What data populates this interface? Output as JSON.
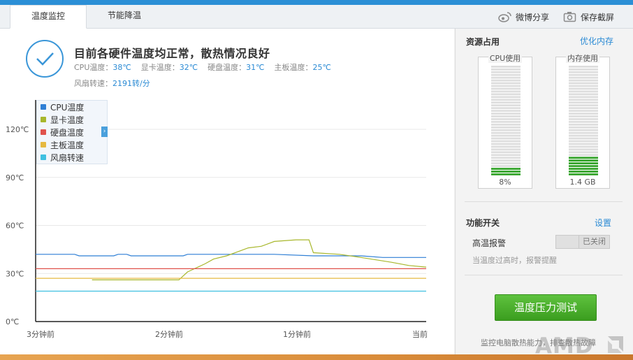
{
  "tabs": [
    {
      "label": "温度监控",
      "active": true
    },
    {
      "label": "节能降温",
      "active": false
    }
  ],
  "toolbar": {
    "share_label": "微博分享",
    "screenshot_label": "保存截屏"
  },
  "status": {
    "headline": "目前各硬件温度均正常，散热情况良好",
    "cpu_label": "CPU温度：",
    "cpu_value": "38℃",
    "gpu_label": "显卡温度：",
    "gpu_value": "32℃",
    "disk_label": "硬盘温度：",
    "disk_value": "31℃",
    "board_label": "主板温度：",
    "board_value": "25℃",
    "fan_label": "风扇转速：",
    "fan_value": "2191转/分"
  },
  "chart_data": {
    "type": "line",
    "y_ticks": [
      "120℃",
      "90℃",
      "60℃",
      "30℃",
      "0℃"
    ],
    "ylim": [
      0,
      120
    ],
    "x_ticks": [
      "3分钟前",
      "2分钟前",
      "1分钟前",
      "当前"
    ],
    "xlim": [
      0,
      180
    ],
    "grid": true,
    "legend_position": "top-left",
    "series": [
      {
        "name": "CPU温度",
        "color": "#2f7fd5",
        "points": [
          [
            0,
            42
          ],
          [
            18,
            42
          ],
          [
            20,
            41
          ],
          [
            36,
            41
          ],
          [
            38,
            42
          ],
          [
            42,
            42
          ],
          [
            44,
            41
          ],
          [
            66,
            41
          ],
          [
            68,
            41
          ],
          [
            70,
            42
          ],
          [
            110,
            42
          ],
          [
            128,
            41
          ],
          [
            140,
            41
          ],
          [
            150,
            41
          ],
          [
            160,
            40
          ],
          [
            180,
            40
          ]
        ]
      },
      {
        "name": "显卡温度",
        "color": "#a8b72c",
        "points": [
          [
            26,
            26
          ],
          [
            66,
            26
          ],
          [
            70,
            31
          ],
          [
            78,
            36
          ],
          [
            82,
            39
          ],
          [
            88,
            41
          ],
          [
            94,
            44
          ],
          [
            98,
            46
          ],
          [
            104,
            47
          ],
          [
            110,
            50
          ],
          [
            120,
            51
          ],
          [
            126,
            51
          ],
          [
            128,
            43
          ],
          [
            140,
            42
          ],
          [
            150,
            40
          ],
          [
            164,
            37
          ],
          [
            172,
            35
          ],
          [
            180,
            34
          ]
        ]
      },
      {
        "name": "硬盘温度",
        "color": "#e0524c",
        "points": [
          [
            0,
            33
          ],
          [
            180,
            33
          ]
        ]
      },
      {
        "name": "主板温度",
        "color": "#e6b940",
        "points": [
          [
            0,
            27
          ],
          [
            180,
            27
          ]
        ]
      },
      {
        "name": "风扇转速",
        "color": "#3fc0e0",
        "points": [
          [
            0,
            19
          ],
          [
            180,
            19
          ]
        ]
      }
    ]
  },
  "resources": {
    "title": "资源占用",
    "optimize_label": "优化内存",
    "cpu_title": "CPU使用",
    "cpu_value": "8%",
    "cpu_fraction": 0.08,
    "mem_title": "内存使用",
    "mem_value": "1.4 GB",
    "mem_fraction": 0.17
  },
  "functions": {
    "title": "功能开关",
    "settings_label": "设置",
    "alarm_label": "高温报警",
    "alarm_state": "已关闭",
    "alarm_hint": "当温度过高时，报警提醒"
  },
  "stress": {
    "button_label": "温度压力测试",
    "description": "监控电脑散热能力，排查散热故障"
  },
  "watermark": "AMD"
}
